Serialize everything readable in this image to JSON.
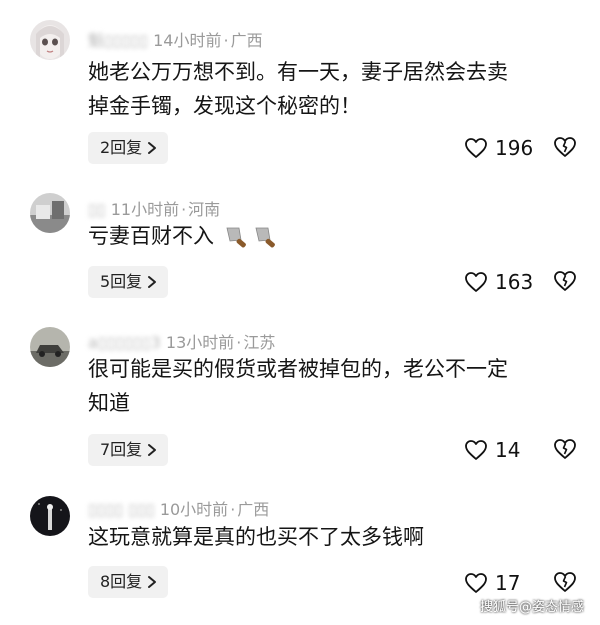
{
  "comments": [
    {
      "username": "魁▯▯▯▯▯",
      "time": "14小时前",
      "location": "广西",
      "text_lines": [
        "她老公万万想不到。有一天，妻子居然会去卖",
        "掉金手镯，发现这个秘密的！"
      ],
      "reply_label": "2回复",
      "likes": "196",
      "avatar": "doll-girl-avatar"
    },
    {
      "username": "▯▯",
      "time": "11小时前",
      "location": "河南",
      "text_lines": [
        "亏妻百财不入"
      ],
      "emoji": "knife-emoji",
      "reply_label": "5回复",
      "likes": "163",
      "avatar": "photo-avatar"
    },
    {
      "username": "a▯▯▯▯▯▯3",
      "time": "13小时前",
      "location": "江苏",
      "text_lines": [
        "很可能是买的假货或者被掉包的，老公不一定",
        "知道"
      ],
      "reply_label": "7回复",
      "likes": "14",
      "avatar": "car-photo-avatar"
    },
    {
      "username": "▯▯▯▯  ▯▯▯",
      "time": "10小时前",
      "location": "广西",
      "text_lines": [
        "这玩意就算是真的也买不了太多钱啊"
      ],
      "reply_label": "8回复",
      "likes": "17",
      "avatar": "night-photo-avatar"
    }
  ],
  "separator": "·",
  "watermark": "搜狐号@姿态情感",
  "colors": {
    "meta_text": "#9a9a9a",
    "reply_bg": "#f1f1f1",
    "body_text": "#151515"
  }
}
